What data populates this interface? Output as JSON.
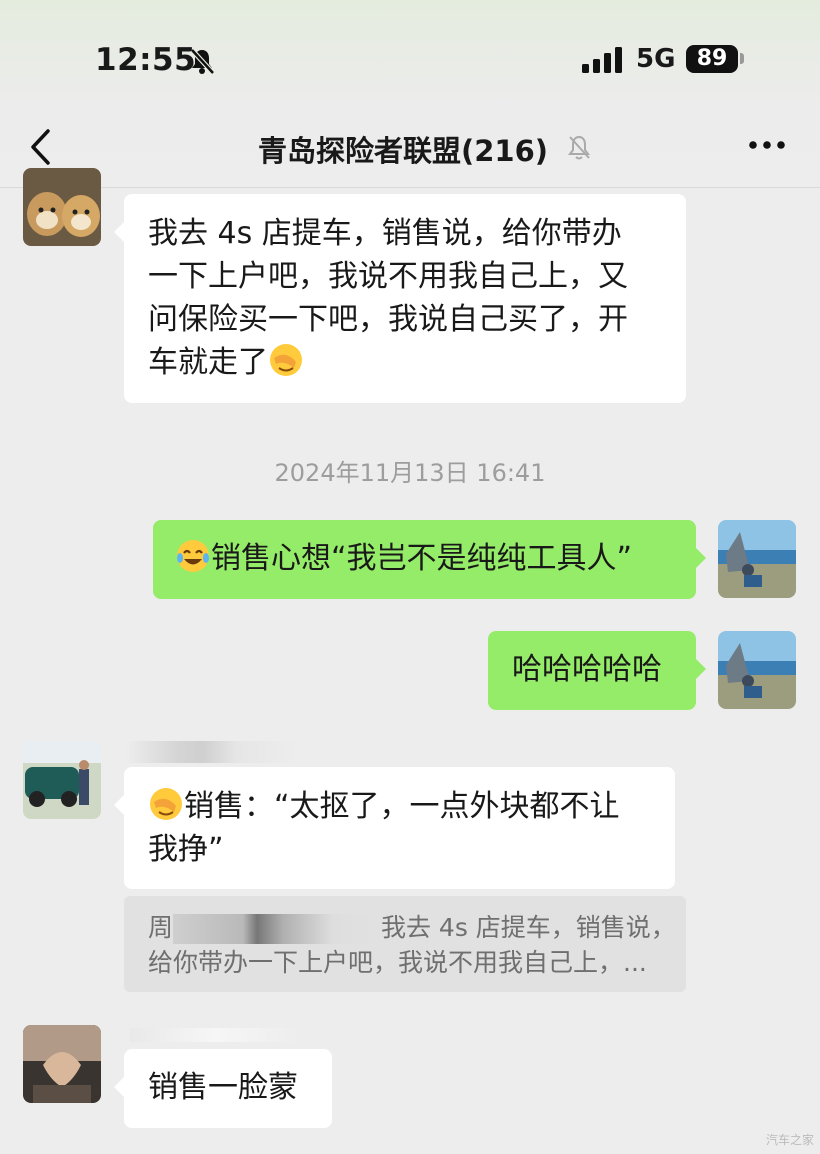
{
  "status_bar": {
    "time": "12:55",
    "network": "5G",
    "battery": "89"
  },
  "header": {
    "title": "青岛探险者联盟(216)"
  },
  "icons": {
    "back": "chevron-left-icon",
    "mute": "bell-slash-icon",
    "more": "more-horizontal-icon",
    "emoji": "face-emoji-icon"
  },
  "colors": {
    "background": "#ededed",
    "bubble_in": "#ffffff",
    "bubble_out": "#95ec69",
    "timestamp": "#9d9d9d",
    "quote_bg": "#e1e1e1"
  },
  "messages": [
    {
      "side": "in",
      "lines": [
        "我去 4s 店提车，销售说，给你带办",
        "一下上户吧，我说不用我自己上，又",
        "问保险买一下吧，我说自己买了，开"
      ],
      "last_line": "车就走了"
    },
    {
      "side": "out",
      "text": "销售心想“我岂不是纯纯工具人”"
    },
    {
      "side": "out",
      "text": "哈哈哈哈哈"
    },
    {
      "side": "in",
      "lines": [
        "销售：“太抠了，一点外块都不让"
      ],
      "last_line": "我挣”"
    },
    {
      "side": "in",
      "text": "销售一脸蒙"
    }
  ],
  "timestamp": "2024年11月13日 16:41",
  "quote": {
    "prefix": "周",
    "line1": "我去 4s 店提车，销售说，",
    "line2": "给你带办一下上户吧，我说不用我自己上，..."
  },
  "watermark": "汽车之家"
}
